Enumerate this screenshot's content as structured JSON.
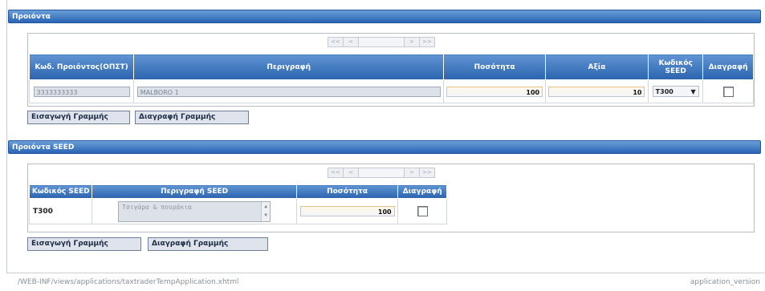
{
  "products": {
    "title": "Προιόντα",
    "pager": {
      "first": "<<",
      "prev": "<",
      "next": ">",
      "last": ">>"
    },
    "columns": [
      "Κωδ. Προιόντος(ΟΠΣΤ)",
      "Περιγραφή",
      "Ποσότητα",
      "Αξία",
      "Κωδικός SEED",
      "Διαγραφή"
    ],
    "row": {
      "code": "3333333333",
      "description": "MALBORO 1",
      "quantity": "100",
      "value": "10",
      "seed_code": "T300"
    },
    "insert_label": "Εισαγωγή Γραμμής",
    "delete_label": "Διαγραφή Γραμμής"
  },
  "seed_products": {
    "title": "Προιόντα SEED",
    "pager": {
      "first": "<<",
      "prev": "<",
      "next": ">",
      "last": ">>"
    },
    "columns": [
      "Κωδικός SEED",
      "Περιγραφή SEED",
      "Ποσότητα",
      "Διαγραφή"
    ],
    "row": {
      "code": "T300",
      "description": "Τσιγάρα & πουράκια",
      "quantity": "100"
    },
    "insert_label": "Εισαγωγή Γραμμής",
    "delete_label": "Διαγραφή Γραμμής"
  },
  "footer": {
    "path": "/WEB-INF/views/applications/taxtraderTempApplication.xhtml",
    "version": "application_version"
  }
}
